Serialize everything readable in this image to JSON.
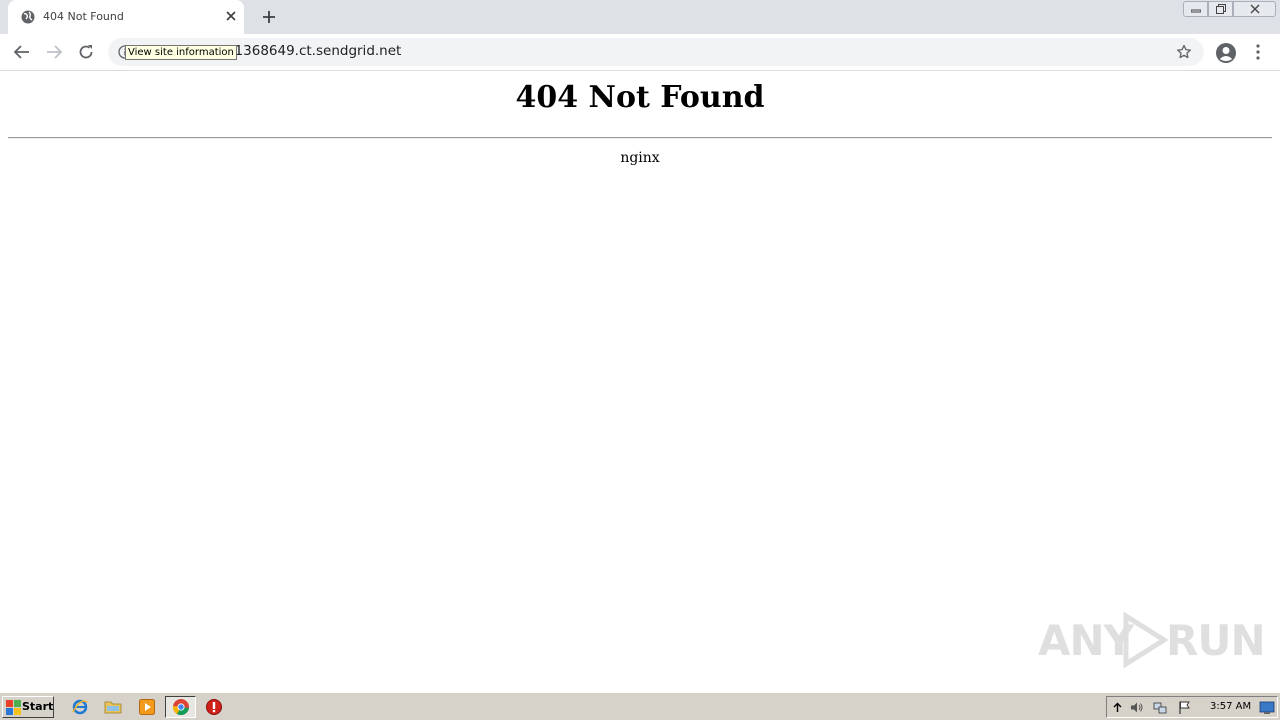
{
  "browser": {
    "tab": {
      "title": "404 Not Found",
      "favicon": "globe-icon"
    },
    "address_bar": {
      "url": "u1368649.ct.sendgrid.net",
      "tooltip": "View site information"
    }
  },
  "page": {
    "heading": "404 Not Found",
    "server": "nginx"
  },
  "watermark": {
    "left": "ANY",
    "right": "RUN"
  },
  "taskbar": {
    "start_label": "Start",
    "clock": "3:57 AM",
    "apps": [
      "internet-explorer-icon",
      "folder-icon",
      "media-player-icon",
      "chrome-icon",
      "stop-icon"
    ]
  },
  "colors": {
    "tabstrip": "#dee1e6",
    "omnibox": "#f1f3f4",
    "taskbar": "#d6d2c9"
  }
}
